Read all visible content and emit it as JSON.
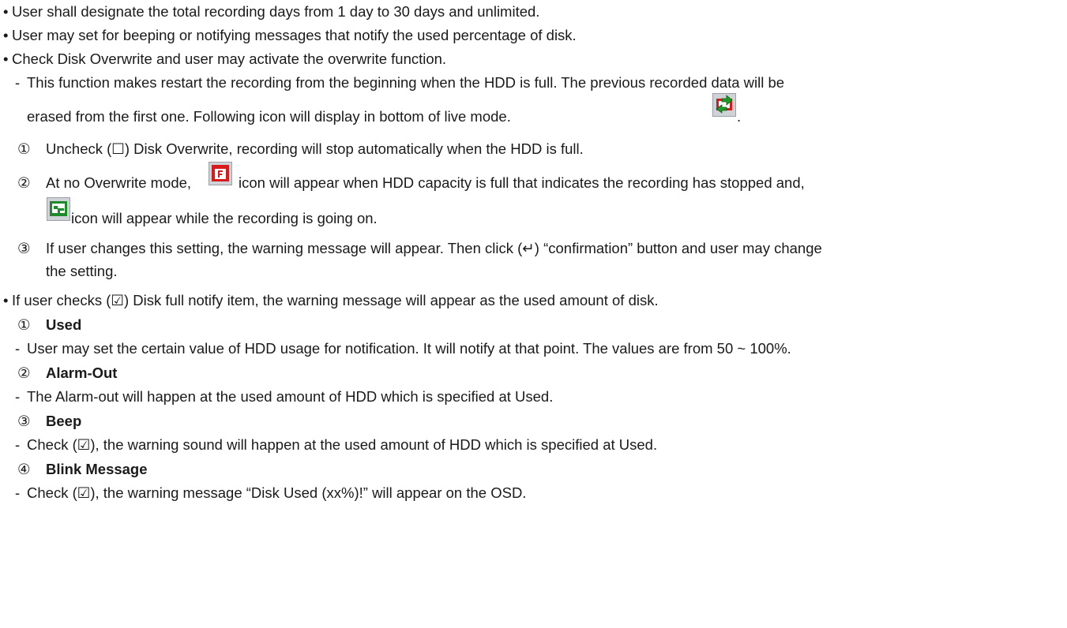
{
  "bullet": "•",
  "dash": "-",
  "nums": [
    "①",
    "②",
    "③",
    "④"
  ],
  "lines": {
    "b1": "User shall designate the total recording days from 1 day to 30 days and unlimited.",
    "b2": "User may set for beeping or notifying messages that notify the used percentage of disk.",
    "b3": "Check Disk Overwrite and user may activate the overwrite function.",
    "d1": "This function makes restart the recording from the beginning when the HDD is full. The previous recorded data will be",
    "d1b": "erased from the first one. Following icon will display in bottom of live mode.",
    "d1b_end": ".",
    "n1": "Uncheck (☐) Disk Overwrite, recording will stop automatically when the HDD is full.",
    "n2a": "At no Overwrite mode,",
    "n2b": "icon will appear when HDD capacity is full that indicates the recording has stopped and,",
    "n2c": "icon will appear while the recording is going on.",
    "n3a": "If user changes this setting, the warning message will appear. Then click (↵) “confirmation” button and user may change",
    "n3b": "the setting.",
    "b4": "If user checks (☑) Disk full notify item, the warning message will appear as the used amount of disk.",
    "h1": "Used",
    "h1d": "User may set the certain value of HDD usage for notification. It will notify at that point. The values are from 50 ~ 100%.",
    "h2": "Alarm-Out",
    "h2d": "The Alarm-out will happen at the used amount of HDD which is specified at Used.",
    "h3": "Beep",
    "h3d": "Check (☑), the warning sound will happen at the used amount of HDD which is specified at Used.",
    "h4": "Blink Message",
    "h4d": "Check (☑), the warning message “Disk Used (xx%)!” will appear on the OSD."
  },
  "icons": {
    "overwrite": "overwrite-icon",
    "disk_full": "disk-full-icon",
    "recording": "recording-icon"
  }
}
